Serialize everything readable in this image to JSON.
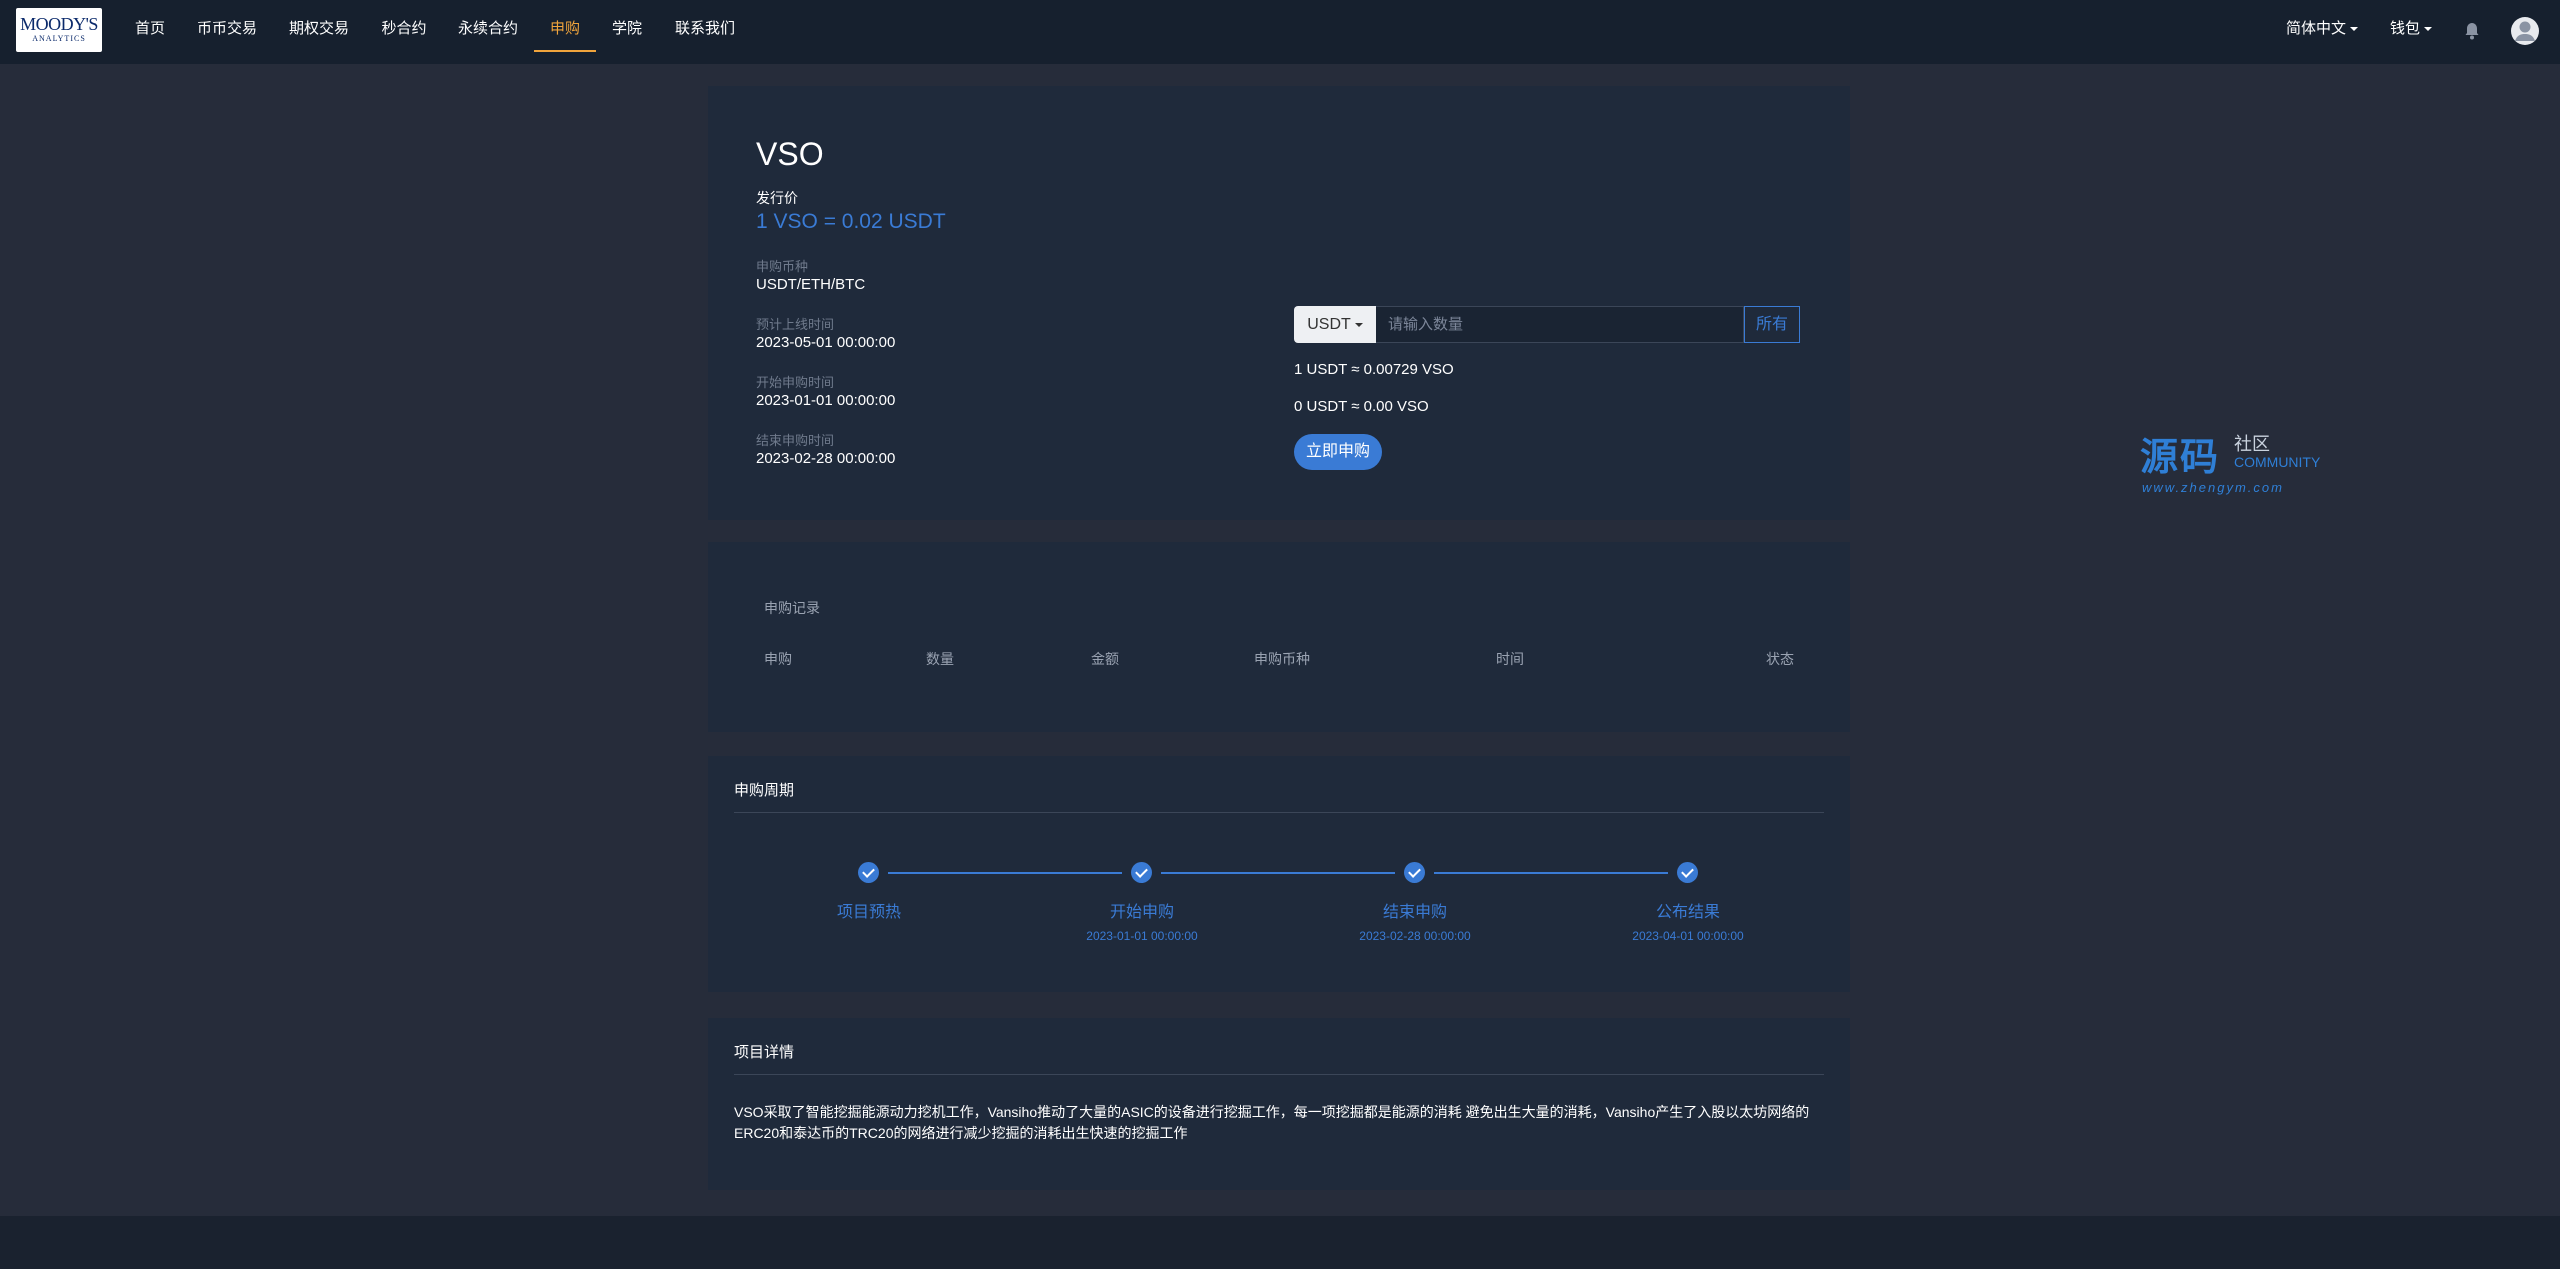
{
  "nav": {
    "logo_line1": "MOODY'S",
    "logo_line2": "ANALYTICS",
    "items": [
      {
        "label": "首页"
      },
      {
        "label": "币币交易"
      },
      {
        "label": "期权交易"
      },
      {
        "label": "秒合约"
      },
      {
        "label": "永续合约"
      },
      {
        "label": "申购",
        "active": true
      },
      {
        "label": "学院"
      },
      {
        "label": "联系我们"
      }
    ],
    "language": "简体中文",
    "wallet": "钱包"
  },
  "token": {
    "name": "VSO",
    "issue_price_label": "发行价",
    "issue_price": "1 VSO = 0.02 USDT",
    "subscribe_currency_label": "申购币种",
    "subscribe_currency": "USDT/ETH/BTC",
    "listing_time_label": "预计上线时间",
    "listing_time": "2023-05-01 00:00:00",
    "start_time_label": "开始申购时间",
    "start_time": "2023-01-01 00:00:00",
    "end_time_label": "结束申购时间",
    "end_time": "2023-02-28 00:00:00"
  },
  "form": {
    "currency": "USDT",
    "amount_placeholder": "请输入数量",
    "all_label": "所有",
    "rate": "1 USDT ≈ 0.00729 VSO",
    "estimate": "0 USDT ≈ 0.00 VSO",
    "submit_label": "立即申购"
  },
  "records": {
    "title": "申购记录",
    "columns": [
      "申购",
      "数量",
      "金额",
      "申购币种",
      "时间",
      "状态"
    ]
  },
  "cycle": {
    "title": "申购周期",
    "steps": [
      {
        "label": "项目预热",
        "date": ""
      },
      {
        "label": "开始申购",
        "date": "2023-01-01 00:00:00"
      },
      {
        "label": "结束申购",
        "date": "2023-02-28 00:00:00"
      },
      {
        "label": "公布结果",
        "date": "2023-04-01 00:00:00"
      }
    ]
  },
  "details": {
    "title": "项目详情",
    "text_line1": "VSO采取了智能挖掘能源动力挖机工作，Vansiho推动了大量的ASIC的设备进行挖掘工作，每一项挖掘都是能源的消耗 避免出生大量的消耗，Vansiho产生了入股以太坊网络的",
    "text_line2": "ERC20和泰达币的TRC20的网络进行减少挖掘的消耗出生快速的挖掘工作"
  },
  "watermark": {
    "main": "源码",
    "sub1": "社区",
    "sub2": "COMMUNITY",
    "url": "www.zhengym.com"
  },
  "colors": {
    "accent": "#3a7bd5",
    "active_nav": "#f0a43c",
    "background": "#262c3a",
    "panel": "#1f2a3b",
    "navbar": "#16202e"
  }
}
